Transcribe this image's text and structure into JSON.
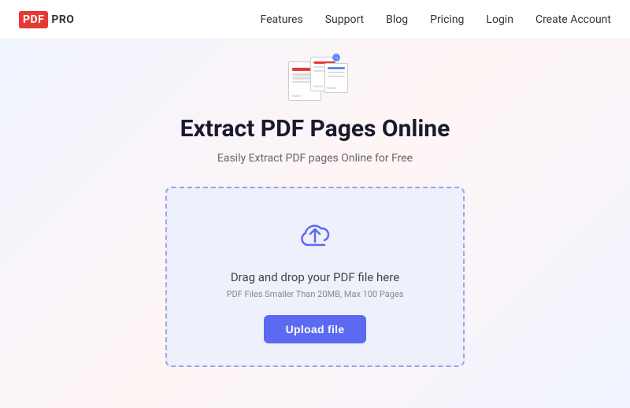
{
  "header": {
    "logo": {
      "pdf": "PDF",
      "pro": "PRO"
    },
    "nav": {
      "items": [
        {
          "label": "Features",
          "key": "features"
        },
        {
          "label": "Support",
          "key": "support"
        },
        {
          "label": "Blog",
          "key": "blog"
        },
        {
          "label": "Pricing",
          "key": "pricing"
        },
        {
          "label": "Login",
          "key": "login"
        },
        {
          "label": "Create Account",
          "key": "create-account"
        }
      ]
    }
  },
  "main": {
    "title": "Extract PDF Pages Online",
    "subtitle": "Easily Extract PDF pages Online for Free",
    "upload": {
      "drag_text": "Drag and drop your PDF file here",
      "limit_text": "PDF Files Smaller Than 20MB, Max 100 Pages",
      "button_label": "Upload file"
    }
  }
}
